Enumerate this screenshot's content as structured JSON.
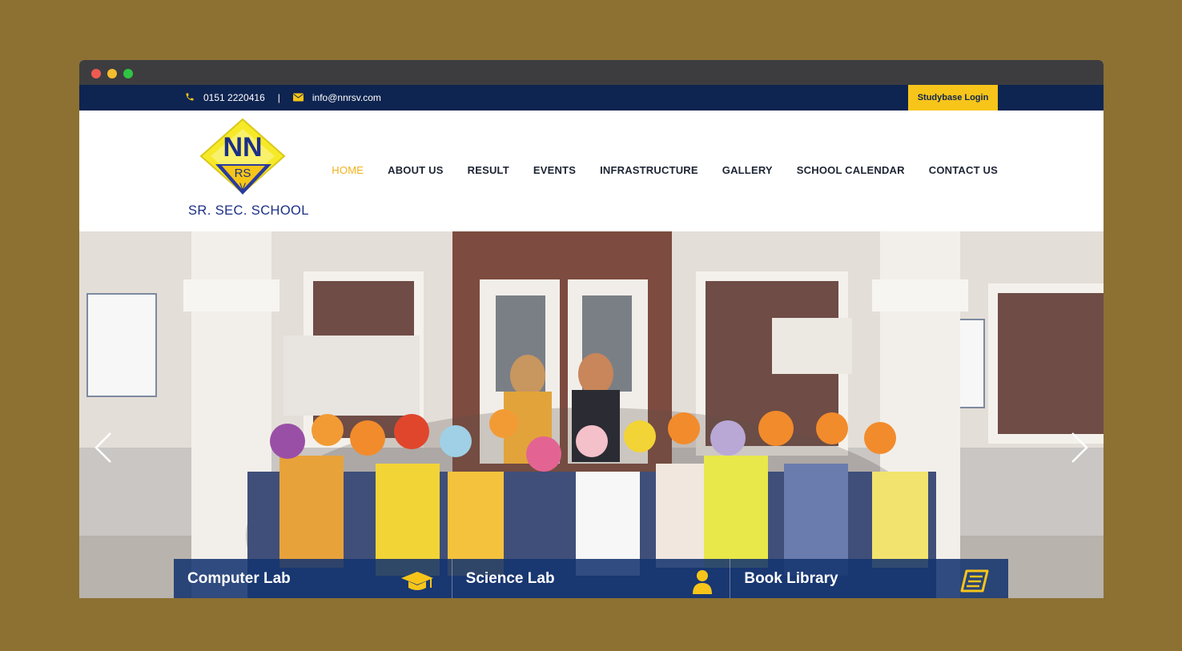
{
  "topbar": {
    "phone_icon": "phone-icon",
    "phone": "0151 2220416",
    "separator": "|",
    "email_icon": "envelope-icon",
    "email": "info@nnrsv.com",
    "login_label": "Studybase Login"
  },
  "logo": {
    "mark_top": "NN",
    "mark_middle": "RS",
    "mark_bottom": "V",
    "text": "SR. SEC. SCHOOL"
  },
  "nav": {
    "items": [
      {
        "label": "HOME",
        "active": true
      },
      {
        "label": "ABOUT US"
      },
      {
        "label": "RESULT"
      },
      {
        "label": "EVENTS"
      },
      {
        "label": "INFRASTRUCTURE"
      },
      {
        "label": "GALLERY"
      },
      {
        "label": "SCHOOL CALENDAR"
      },
      {
        "label": "CONTACT US"
      }
    ]
  },
  "features": [
    {
      "label": "Computer Lab",
      "icon": "graduation-cap-icon"
    },
    {
      "label": "Science Lab",
      "icon": "user-icon"
    },
    {
      "label": "Book Library",
      "icon": "book-icon"
    }
  ],
  "colors": {
    "background": "#8c7133",
    "navy": "#0e2451",
    "accent": "#f7c51a",
    "feature_bar": "#153470"
  }
}
